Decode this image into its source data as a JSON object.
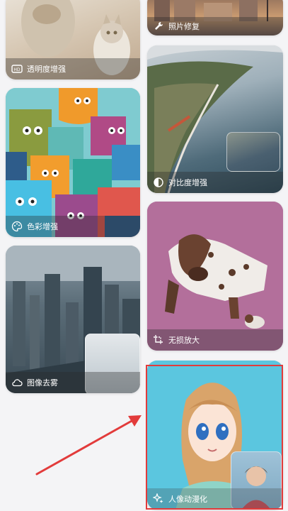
{
  "cards": {
    "transparency": {
      "label": "透明度增强",
      "icon": "hd-icon"
    },
    "photo_repair": {
      "label": "照片修复",
      "icon": "wrench-icon"
    },
    "color_enhance": {
      "label": "色彩增强",
      "icon": "palette-icon"
    },
    "contrast_enhance": {
      "label": "对比度增强",
      "icon": "contrast-icon"
    },
    "dehaze": {
      "label": "图像去雾",
      "icon": "cloud-icon"
    },
    "lossless_zoom": {
      "label": "无损放大",
      "icon": "crop-icon"
    },
    "portrait_anime": {
      "label": "人像动漫化",
      "icon": "sparkle-icon"
    }
  },
  "annotation": {
    "arrow_color": "#e23b3b",
    "highlight_target": "portrait_anime"
  }
}
